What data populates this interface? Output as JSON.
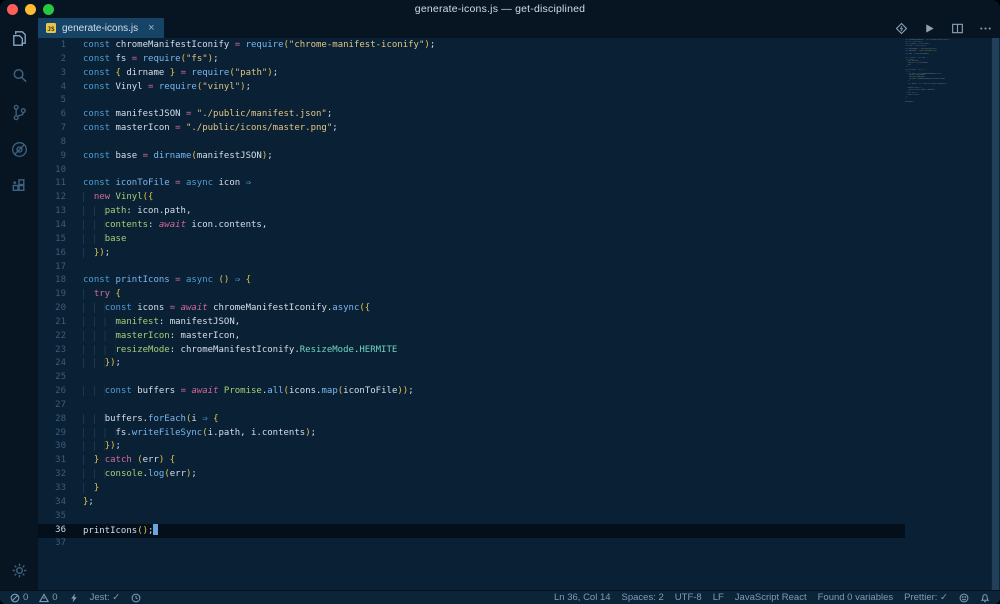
{
  "window": {
    "title": "generate-icons.js — get-disciplined"
  },
  "colors": {
    "chrome_bg": "#071523",
    "editor_bg": "#0a2135",
    "tab_active_bg": "#164467",
    "status_bg": "#0b2437",
    "line_highlight": "#040f1c",
    "keyword_blue": "#4f9cd6",
    "function_blue": "#7ab6f0",
    "string_yellow": "#e4c384",
    "punct_yellow": "#e2c14c",
    "green": "#a5ce77",
    "teal": "#6fd4be",
    "magenta": "#d4689c",
    "default_text": "#d5deeb",
    "js_badge_yellow": "#e8c64b"
  },
  "tab": {
    "label": "generate-icons.js",
    "icon_text": "JS",
    "close_glyph": "×"
  },
  "activity_bar": {
    "items": [
      "explorer-icon",
      "search-icon",
      "source-control-icon",
      "debug-icon",
      "extensions-icon"
    ],
    "bottom": [
      "settings-gear-icon"
    ]
  },
  "editor_actions": [
    "format-diamond-icon",
    "run-icon",
    "split-editor-icon",
    "more-actions-icon"
  ],
  "editor": {
    "line_count": 37,
    "cursor_line": 36,
    "lines": [
      [
        [
          "kw",
          "const"
        ],
        [
          "df",
          " chromeManifestIconify "
        ],
        [
          "mg",
          "="
        ],
        [
          "df",
          " "
        ],
        [
          "fn",
          "require"
        ],
        [
          "pn",
          "("
        ],
        [
          "st",
          "\"chrome-manifest-iconify\""
        ],
        [
          "pn",
          ")"
        ],
        [
          "df",
          ";"
        ]
      ],
      [
        [
          "kw",
          "const"
        ],
        [
          "df",
          " fs "
        ],
        [
          "mg",
          "="
        ],
        [
          "df",
          " "
        ],
        [
          "fn",
          "require"
        ],
        [
          "pn",
          "("
        ],
        [
          "st",
          "\"fs\""
        ],
        [
          "pn",
          ")"
        ],
        [
          "df",
          ";"
        ]
      ],
      [
        [
          "kw",
          "const"
        ],
        [
          "df",
          " "
        ],
        [
          "pn",
          "{"
        ],
        [
          "df",
          " dirname "
        ],
        [
          "pn",
          "}"
        ],
        [
          "df",
          " "
        ],
        [
          "mg",
          "="
        ],
        [
          "df",
          " "
        ],
        [
          "fn",
          "require"
        ],
        [
          "pn",
          "("
        ],
        [
          "st",
          "\"path\""
        ],
        [
          "pn",
          ")"
        ],
        [
          "df",
          ";"
        ]
      ],
      [
        [
          "kw",
          "const"
        ],
        [
          "df",
          " Vinyl "
        ],
        [
          "mg",
          "="
        ],
        [
          "df",
          " "
        ],
        [
          "fn",
          "require"
        ],
        [
          "pn",
          "("
        ],
        [
          "st",
          "\"vinyl\""
        ],
        [
          "pn",
          ")"
        ],
        [
          "df",
          ";"
        ]
      ],
      [],
      [
        [
          "kw",
          "const"
        ],
        [
          "df",
          " manifestJSON "
        ],
        [
          "mg",
          "="
        ],
        [
          "df",
          " "
        ],
        [
          "st",
          "\"./public/manifest.json\""
        ],
        [
          "df",
          ";"
        ]
      ],
      [
        [
          "kw",
          "const"
        ],
        [
          "df",
          " masterIcon "
        ],
        [
          "mg",
          "="
        ],
        [
          "df",
          " "
        ],
        [
          "st",
          "\"./public/icons/master.png\""
        ],
        [
          "df",
          ";"
        ]
      ],
      [],
      [
        [
          "kw",
          "const"
        ],
        [
          "df",
          " base "
        ],
        [
          "mg",
          "="
        ],
        [
          "df",
          " "
        ],
        [
          "fn",
          "dirname"
        ],
        [
          "pn",
          "("
        ],
        [
          "df",
          "manifestJSON"
        ],
        [
          "pn",
          ")"
        ],
        [
          "df",
          ";"
        ]
      ],
      [],
      [
        [
          "kw",
          "const"
        ],
        [
          "df",
          " "
        ],
        [
          "fn",
          "iconToFile"
        ],
        [
          "df",
          " "
        ],
        [
          "mg",
          "="
        ],
        [
          "df",
          " "
        ],
        [
          "kw",
          "async"
        ],
        [
          "df",
          " icon "
        ],
        [
          "kw",
          "⇒"
        ]
      ],
      [
        [
          "ws",
          "  "
        ],
        [
          "mg",
          "new"
        ],
        [
          "df",
          " "
        ],
        [
          "pr",
          "Vinyl"
        ],
        [
          "pn",
          "({"
        ]
      ],
      [
        [
          "ws",
          "    "
        ],
        [
          "pr",
          "path"
        ],
        [
          "df",
          ": icon.path,"
        ]
      ],
      [
        [
          "ws",
          "    "
        ],
        [
          "pr",
          "contents"
        ],
        [
          "df",
          ": "
        ],
        [
          "aw",
          "await"
        ],
        [
          "df",
          " icon.contents,"
        ]
      ],
      [
        [
          "ws",
          "    "
        ],
        [
          "pr",
          "base"
        ]
      ],
      [
        [
          "ws",
          "  "
        ],
        [
          "pn",
          "})"
        ],
        [
          "df",
          ";"
        ]
      ],
      [],
      [
        [
          "kw",
          "const"
        ],
        [
          "df",
          " "
        ],
        [
          "fn",
          "printIcons"
        ],
        [
          "df",
          " "
        ],
        [
          "mg",
          "="
        ],
        [
          "df",
          " "
        ],
        [
          "kw",
          "async"
        ],
        [
          "df",
          " "
        ],
        [
          "pn",
          "()"
        ],
        [
          "df",
          " "
        ],
        [
          "kw",
          "⇒"
        ],
        [
          "df",
          " "
        ],
        [
          "pn",
          "{"
        ]
      ],
      [
        [
          "ws",
          "  "
        ],
        [
          "mg",
          "try"
        ],
        [
          "df",
          " "
        ],
        [
          "pn",
          "{"
        ]
      ],
      [
        [
          "ws",
          "    "
        ],
        [
          "kw",
          "const"
        ],
        [
          "df",
          " icons "
        ],
        [
          "mg",
          "="
        ],
        [
          "df",
          " "
        ],
        [
          "aw",
          "await"
        ],
        [
          "df",
          " chromeManifestIconify."
        ],
        [
          "fn",
          "async"
        ],
        [
          "pn",
          "({"
        ]
      ],
      [
        [
          "ws",
          "      "
        ],
        [
          "pr",
          "manifest"
        ],
        [
          "df",
          ": manifestJSON,"
        ]
      ],
      [
        [
          "ws",
          "      "
        ],
        [
          "pr",
          "masterIcon"
        ],
        [
          "df",
          ": masterIcon,"
        ]
      ],
      [
        [
          "ws",
          "      "
        ],
        [
          "pr",
          "resizeMode"
        ],
        [
          "df",
          ": chromeManifestIconify."
        ],
        [
          "tl",
          "ResizeMode"
        ],
        [
          "df",
          "."
        ],
        [
          "tl",
          "HERMITE"
        ]
      ],
      [
        [
          "ws",
          "    "
        ],
        [
          "pn",
          "})"
        ],
        [
          "df",
          ";"
        ]
      ],
      [],
      [
        [
          "ws",
          "    "
        ],
        [
          "kw",
          "const"
        ],
        [
          "df",
          " buffers "
        ],
        [
          "mg",
          "="
        ],
        [
          "df",
          " "
        ],
        [
          "aw",
          "await"
        ],
        [
          "df",
          " "
        ],
        [
          "pr",
          "Promise"
        ],
        [
          "df",
          "."
        ],
        [
          "fn",
          "all"
        ],
        [
          "pn",
          "("
        ],
        [
          "df",
          "icons."
        ],
        [
          "fn",
          "map"
        ],
        [
          "pn",
          "("
        ],
        [
          "df",
          "iconToFile"
        ],
        [
          "pn",
          "))"
        ],
        [
          "df",
          ";"
        ]
      ],
      [],
      [
        [
          "ws",
          "    "
        ],
        [
          "df",
          "buffers."
        ],
        [
          "fn",
          "forEach"
        ],
        [
          "pn",
          "("
        ],
        [
          "df",
          "i "
        ],
        [
          "kw",
          "⇒"
        ],
        [
          "df",
          " "
        ],
        [
          "pn",
          "{"
        ]
      ],
      [
        [
          "ws",
          "      "
        ],
        [
          "df",
          "fs."
        ],
        [
          "fn",
          "writeFileSync"
        ],
        [
          "pn",
          "("
        ],
        [
          "df",
          "i.path, i.contents"
        ],
        [
          "pn",
          ")"
        ],
        [
          "df",
          ";"
        ]
      ],
      [
        [
          "ws",
          "    "
        ],
        [
          "pn",
          "})"
        ],
        [
          "df",
          ";"
        ]
      ],
      [
        [
          "ws",
          "  "
        ],
        [
          "pn",
          "}"
        ],
        [
          "df",
          " "
        ],
        [
          "mg",
          "catch"
        ],
        [
          "df",
          " "
        ],
        [
          "pn",
          "("
        ],
        [
          "df",
          "err"
        ],
        [
          "pn",
          ")"
        ],
        [
          "df",
          " "
        ],
        [
          "pn",
          "{"
        ]
      ],
      [
        [
          "ws",
          "    "
        ],
        [
          "pr",
          "console"
        ],
        [
          "df",
          "."
        ],
        [
          "fn",
          "log"
        ],
        [
          "pn",
          "("
        ],
        [
          "df",
          "err"
        ],
        [
          "pn",
          ")"
        ],
        [
          "df",
          ";"
        ]
      ],
      [
        [
          "ws",
          "  "
        ],
        [
          "pn",
          "}"
        ]
      ],
      [
        [
          "pn",
          "}"
        ],
        [
          "df",
          ";"
        ]
      ],
      [],
      [
        [
          "df",
          "printIcons"
        ],
        [
          "pn",
          "()"
        ],
        [
          "df",
          ";"
        ]
      ],
      []
    ]
  },
  "status_bar": {
    "left": [
      {
        "icon": "error-circle-icon",
        "label": "0"
      },
      {
        "icon": "warning-triangle-icon",
        "label": "0"
      },
      {
        "icon": "lightning-icon",
        "label": ""
      },
      {
        "icon": "",
        "label": "Jest: ✓"
      },
      {
        "icon": "clock-icon",
        "label": ""
      }
    ],
    "right": [
      {
        "icon": "",
        "label": "Ln 36, Col 14"
      },
      {
        "icon": "",
        "label": "Spaces: 2"
      },
      {
        "icon": "",
        "label": "UTF-8"
      },
      {
        "icon": "",
        "label": "LF"
      },
      {
        "icon": "",
        "label": "JavaScript React"
      },
      {
        "icon": "",
        "label": "Found 0 variables"
      },
      {
        "icon": "",
        "label": "Prettier: ✓"
      },
      {
        "icon": "smiley-icon",
        "label": ""
      },
      {
        "icon": "bell-icon",
        "label": ""
      }
    ]
  }
}
